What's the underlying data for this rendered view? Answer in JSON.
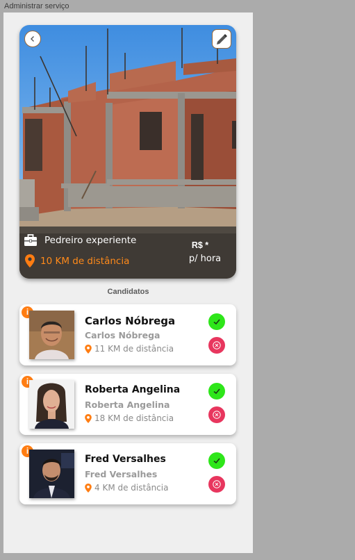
{
  "frame_label": "Administrar serviço",
  "service": {
    "job_title": "Pedreiro experiente",
    "distance": "10 KM de distância",
    "price": "R$ *",
    "price_unit": "p/ hora"
  },
  "candidates_title": "Candidatos",
  "candidates": [
    {
      "name": "Carlos Nóbrega",
      "subtitle": "Carlos Nóbrega",
      "distance": "11 KM de distância"
    },
    {
      "name": "Roberta Angelina",
      "subtitle": "Roberta Angelina",
      "distance": "18 KM de distância"
    },
    {
      "name": "Fred Versalhes",
      "subtitle": "Fred Versalhes",
      "distance": "4 KM de distância"
    }
  ],
  "colors": {
    "accent_orange": "#ff7d12",
    "accept_green": "#2ee61a",
    "reject_red": "#e8365e"
  },
  "icons": {
    "back": "chevron-left-icon",
    "edit": "pencil-icon",
    "job": "briefcase-icon",
    "location": "map-pin-icon",
    "info": "info-icon",
    "accept": "check-icon",
    "reject": "x-circle-icon"
  }
}
